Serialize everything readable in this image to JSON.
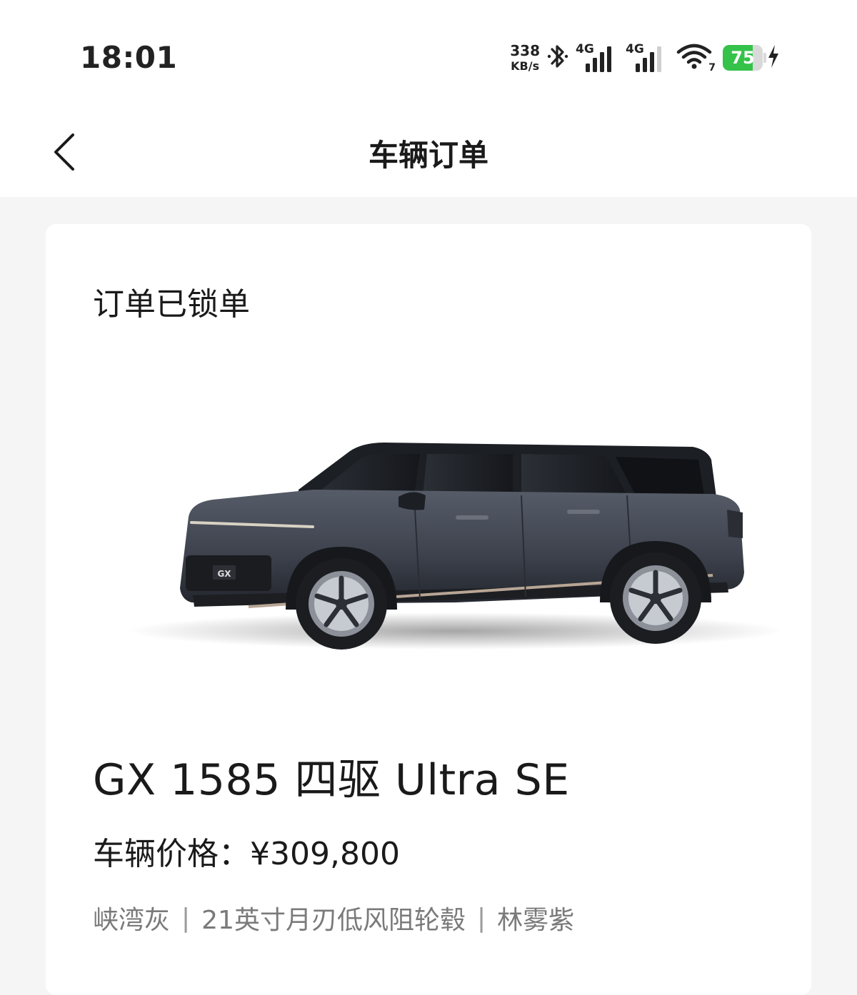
{
  "status_bar": {
    "time": "18:01",
    "net_speed_value": "338",
    "net_speed_unit": "KB/s",
    "signal1_label": "4G",
    "signal2_label": "4G",
    "wifi_level": "7",
    "battery_level": "75",
    "icons": [
      "bluetooth-icon",
      "signal-icon",
      "signal-icon",
      "wifi-icon",
      "battery-icon",
      "charging-icon"
    ]
  },
  "nav": {
    "title": "车辆订单",
    "back_icon": "chevron-left-icon"
  },
  "order": {
    "status": "订单已锁单",
    "model_name": "GX 1585 四驱 Ultra SE",
    "price_label": "车辆价格：",
    "price_value": "¥309,800",
    "options": [
      "峡湾灰",
      "21英寸月刃低风阻轮毂",
      "林雾紫"
    ],
    "separator": "|",
    "car_badge": "GX"
  },
  "colors": {
    "battery_green": "#35c24a",
    "car_body": "#3b3f4a",
    "page_bg": "#f5f5f5"
  }
}
